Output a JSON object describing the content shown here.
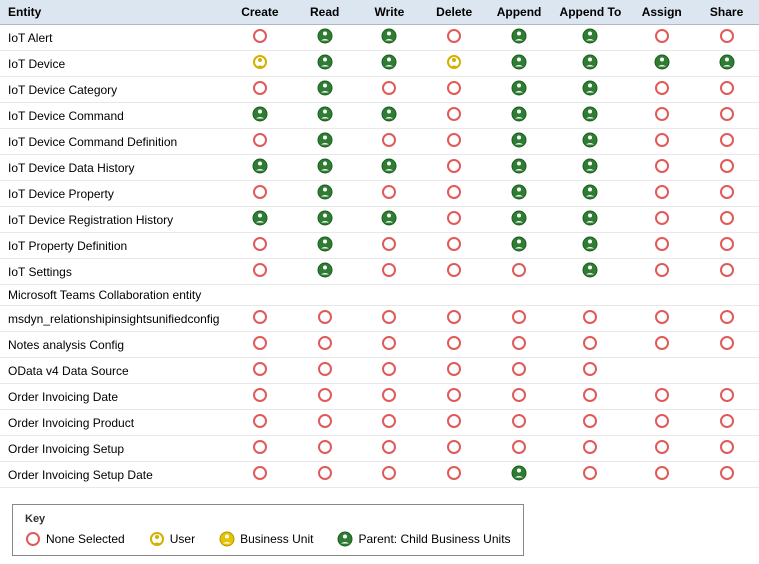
{
  "table": {
    "headers": [
      "Entity",
      "Create",
      "Read",
      "Write",
      "Delete",
      "Append",
      "Append To",
      "Assign",
      "Share"
    ],
    "rows": [
      {
        "entity": "IoT Alert",
        "create": "none",
        "read": "parent",
        "write": "parent",
        "delete": "none",
        "append": "parent",
        "appendTo": "parent",
        "assign": "none",
        "share": "none"
      },
      {
        "entity": "IoT Device",
        "create": "user",
        "read": "parent",
        "write": "parent",
        "delete": "user",
        "append": "parent",
        "appendTo": "parent",
        "assign": "parent",
        "share": "parent"
      },
      {
        "entity": "IoT Device Category",
        "create": "none",
        "read": "parent",
        "write": "none",
        "delete": "none",
        "append": "parent",
        "appendTo": "parent",
        "assign": "none",
        "share": "none"
      },
      {
        "entity": "IoT Device Command",
        "create": "parent",
        "read": "parent",
        "write": "parent",
        "delete": "none",
        "append": "parent",
        "appendTo": "parent",
        "assign": "none",
        "share": "none"
      },
      {
        "entity": "IoT Device Command Definition",
        "create": "none",
        "read": "parent",
        "write": "none",
        "delete": "none",
        "append": "parent",
        "appendTo": "parent",
        "assign": "none",
        "share": "none"
      },
      {
        "entity": "IoT Device Data History",
        "create": "parent",
        "read": "parent",
        "write": "parent",
        "delete": "none",
        "append": "parent",
        "appendTo": "parent",
        "assign": "none",
        "share": "none"
      },
      {
        "entity": "IoT Device Property",
        "create": "none",
        "read": "parent",
        "write": "none",
        "delete": "none",
        "append": "parent",
        "appendTo": "parent",
        "assign": "none",
        "share": "none"
      },
      {
        "entity": "IoT Device Registration History",
        "create": "parent",
        "read": "parent",
        "write": "parent",
        "delete": "none",
        "append": "parent",
        "appendTo": "parent",
        "assign": "none",
        "share": "none"
      },
      {
        "entity": "IoT Property Definition",
        "create": "none",
        "read": "parent",
        "write": "none",
        "delete": "none",
        "append": "parent",
        "appendTo": "parent",
        "assign": "none",
        "share": "none"
      },
      {
        "entity": "IoT Settings",
        "create": "none",
        "read": "parent",
        "write": "none",
        "delete": "none",
        "append": "none",
        "appendTo": "parent",
        "assign": "none",
        "share": "none"
      },
      {
        "entity": "Microsoft Teams Collaboration entity",
        "create": "",
        "read": "",
        "write": "",
        "delete": "",
        "append": "",
        "appendTo": "",
        "assign": "",
        "share": ""
      },
      {
        "entity": "msdyn_relationshipinsightsunifiedconfig",
        "create": "none",
        "read": "none",
        "write": "none",
        "delete": "none",
        "append": "none",
        "appendTo": "none",
        "assign": "none",
        "share": "none"
      },
      {
        "entity": "Notes analysis Config",
        "create": "none",
        "read": "none",
        "write": "none",
        "delete": "none",
        "append": "none",
        "appendTo": "none",
        "assign": "none",
        "share": "none"
      },
      {
        "entity": "OData v4 Data Source",
        "create": "none",
        "read": "none",
        "write": "none",
        "delete": "none",
        "append": "none",
        "appendTo": "none",
        "assign": "",
        "share": ""
      },
      {
        "entity": "Order Invoicing Date",
        "create": "none",
        "read": "none",
        "write": "none",
        "delete": "none",
        "append": "none",
        "appendTo": "none",
        "assign": "none",
        "share": "none"
      },
      {
        "entity": "Order Invoicing Product",
        "create": "none",
        "read": "none",
        "write": "none",
        "delete": "none",
        "append": "none",
        "appendTo": "none",
        "assign": "none",
        "share": "none"
      },
      {
        "entity": "Order Invoicing Setup",
        "create": "none",
        "read": "none",
        "write": "none",
        "delete": "none",
        "append": "none",
        "appendTo": "none",
        "assign": "none",
        "share": "none"
      },
      {
        "entity": "Order Invoicing Setup Date",
        "create": "none",
        "read": "none",
        "write": "none",
        "delete": "none",
        "append": "parent",
        "appendTo": "none",
        "assign": "none",
        "share": "none"
      }
    ]
  },
  "key": {
    "title": "Key",
    "items": [
      {
        "type": "none",
        "label": "None Selected"
      },
      {
        "type": "user",
        "label": "User"
      },
      {
        "type": "bu",
        "label": "Business Unit"
      },
      {
        "type": "parent",
        "label": "Parent: Child Business Units"
      }
    ]
  }
}
